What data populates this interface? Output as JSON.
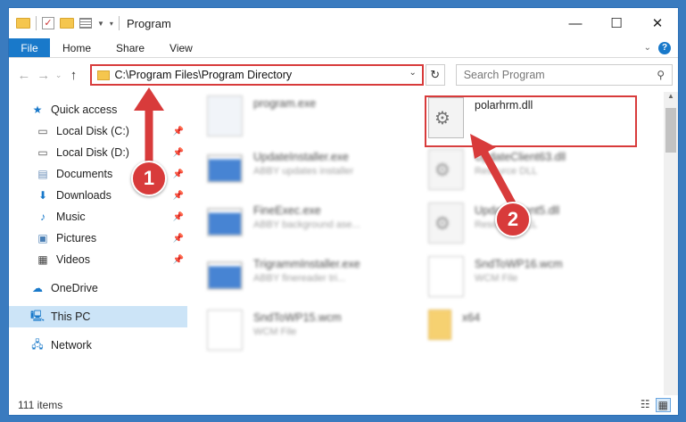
{
  "window": {
    "title": "Program"
  },
  "ribbon": {
    "file": "File",
    "tabs": [
      "Home",
      "Share",
      "View"
    ],
    "help": "?"
  },
  "address": {
    "path": "C:\\Program Files\\Program Directory"
  },
  "search": {
    "placeholder": "Search Program"
  },
  "nav": {
    "quick_access": "Quick access",
    "items": [
      {
        "label": "Local Disk (C:)",
        "icon": "drive-icon"
      },
      {
        "label": "Local Disk (D:)",
        "icon": "drive-icon"
      },
      {
        "label": "Documents",
        "icon": "documents-icon"
      },
      {
        "label": "Downloads",
        "icon": "downloads-icon"
      },
      {
        "label": "Music",
        "icon": "music-icon"
      },
      {
        "label": "Pictures",
        "icon": "pictures-icon"
      },
      {
        "label": "Videos",
        "icon": "videos-icon"
      }
    ],
    "onedrive": "OneDrive",
    "thispc": "This PC",
    "network": "Network"
  },
  "files": [
    {
      "name": "program.exe",
      "sub": ""
    },
    {
      "name": "UpdateInstaller.exe",
      "sub": "ABBY updates installer"
    },
    {
      "name": "FineExec.exe",
      "sub": "ABBY background ase..."
    },
    {
      "name": "TrigrammInstaller.exe",
      "sub": "ABBY finereader tri..."
    },
    {
      "name": "SndToWP15.wcm",
      "sub": "WCM File"
    },
    {
      "name": "polarhrm.dll",
      "sub": ""
    },
    {
      "name": "UpdateClient63.dll",
      "sub": "Resource DLL"
    },
    {
      "name": "UpdateClient5.dll",
      "sub": "Resource DLL"
    },
    {
      "name": "SndToWP16.wcm",
      "sub": "WCM File"
    },
    {
      "name": "x64",
      "sub": ""
    }
  ],
  "status": {
    "count": "111 items"
  },
  "annotations": {
    "step1": "1",
    "step2": "2"
  },
  "colors": {
    "accent": "#1979ca",
    "annotation": "#d83b3b"
  }
}
